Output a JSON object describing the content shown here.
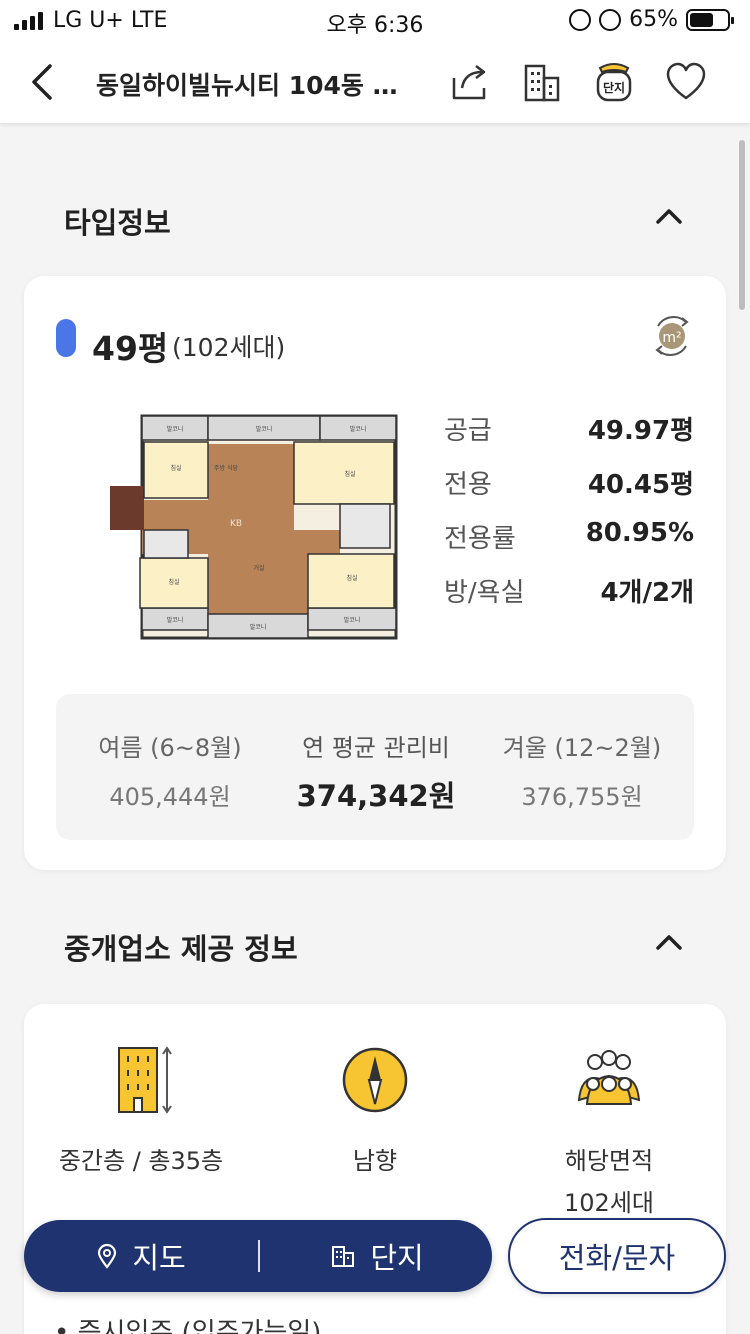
{
  "status": {
    "carrier": "LG U+ LTE",
    "time": "오후 6:36",
    "battery": "65%",
    "battery_level": 0.65
  },
  "nav": {
    "title": "동일하이빌뉴시티 104동 …",
    "icons": [
      "back-icon",
      "share-icon",
      "building-icon",
      "complex-jar-icon",
      "heart-icon"
    ],
    "complex_badge": "단지"
  },
  "type_section": {
    "title": "타입정보",
    "type_name": "49평",
    "households": "(102세대)",
    "unit_toggle": "m²",
    "specs": [
      {
        "label": "공급",
        "value": "49.97평"
      },
      {
        "label": "전용",
        "value": "40.45평"
      },
      {
        "label": "전용률",
        "value": "80.95%"
      },
      {
        "label": "방/욕실",
        "value": "4개/2개"
      }
    ],
    "fees": [
      {
        "label": "여름 (6~8월)",
        "value": "405,444원"
      },
      {
        "label": "연 평균 관리비",
        "value": "374,342원"
      },
      {
        "label": "겨울 (12~2월)",
        "value": "376,755원"
      }
    ],
    "floorplan_rooms": {
      "balcony": "발코니",
      "room": "침실",
      "living": "거실",
      "kitchen": "주방\n식당",
      "watermark": "KB"
    }
  },
  "agent_section": {
    "title": "중개업소 제공 정보",
    "features": [
      {
        "icon": "building-floor-icon",
        "text": "중간층 / 총35층"
      },
      {
        "icon": "compass-icon",
        "text": "남향"
      },
      {
        "icon": "people-icon",
        "text": "해당면적\n102세대"
      }
    ],
    "next_item": "• 즉시입주 (입주가능일)"
  },
  "bottom_bar": {
    "map_label": "지도",
    "complex_label": "단지",
    "call_label": "전화/문자"
  },
  "colors": {
    "navy": "#1e3370",
    "type_blue": "#4a76e8",
    "icon_yellow": "#f7c531"
  }
}
